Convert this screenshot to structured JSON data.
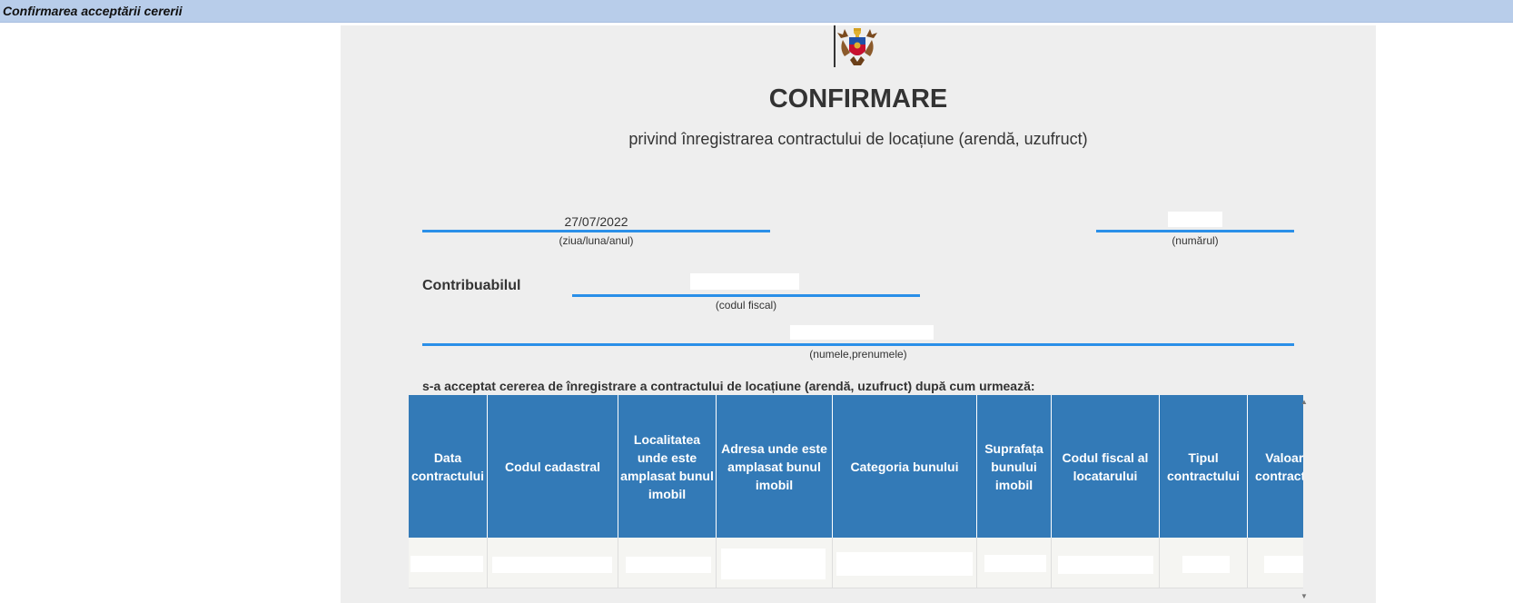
{
  "window": {
    "title": "Confirmarea acceptării cererii"
  },
  "document": {
    "title": "CONFIRMARE",
    "subtitle": "privind înregistrarea contractului de locațiune (arendă, uzufruct)",
    "date_value": "27/07/2022",
    "date_caption": "(ziua/luna/anul)",
    "number_value": "",
    "number_caption": "(numărul)",
    "contributor_label": "Contribuabilul",
    "fiscal_code_value": "",
    "fiscal_code_caption": "(codul fiscal)",
    "name_value": "",
    "name_caption": "(numele,prenumele)",
    "statement": "s-a acceptat cererea de înregistrare a contractului de locațiune (arendă, uzufruct) după cum urmează:"
  },
  "table": {
    "columns": [
      "Data contractului",
      "Codul cadastral",
      "Localitatea unde este amplasat bunul imobil",
      "Adresa unde este amplasat bunul imobil",
      "Categoria bunului",
      "Suprafața bunului imobil",
      "Codul fiscal al locatarului",
      "Tipul contractului",
      "Valoarea contractului"
    ],
    "rows": [
      [
        "",
        "",
        "",
        "",
        "",
        "",
        "",
        "",
        ""
      ]
    ]
  },
  "colors": {
    "title_bar": "#b8cdea",
    "field_line": "#2a8fe8",
    "table_header": "#337ab7",
    "document_background": "#eeeeee"
  },
  "icons": {
    "emblem": "moldova-coat-of-arms-icon",
    "scroll_up": "scroll-up-icon",
    "scroll_down": "scroll-down-icon"
  }
}
